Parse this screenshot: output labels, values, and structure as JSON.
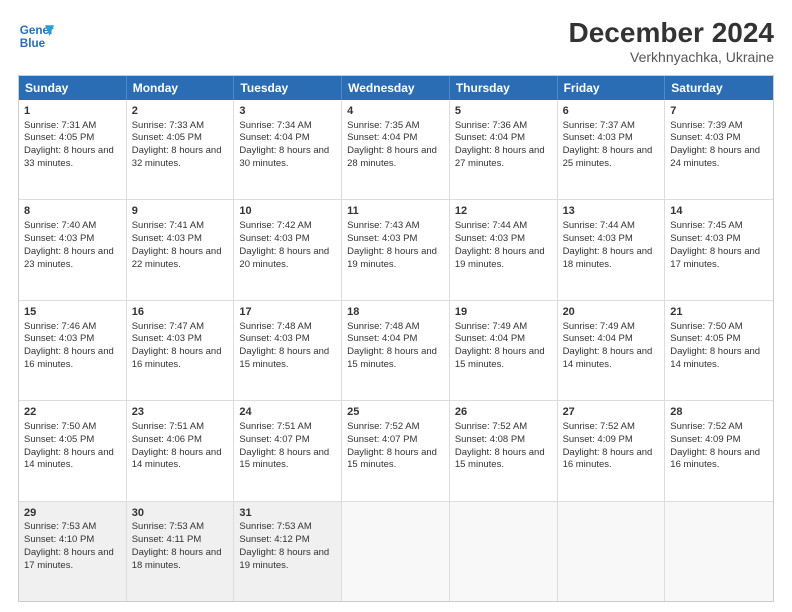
{
  "header": {
    "logo_line1": "General",
    "logo_line2": "Blue",
    "title": "December 2024",
    "subtitle": "Verkhnyachka, Ukraine"
  },
  "days_of_week": [
    "Sunday",
    "Monday",
    "Tuesday",
    "Wednesday",
    "Thursday",
    "Friday",
    "Saturday"
  ],
  "weeks": [
    [
      {
        "day": 1,
        "sunrise": "7:31 AM",
        "sunset": "4:05 PM",
        "daylight": "8 hours and 33 minutes."
      },
      {
        "day": 2,
        "sunrise": "7:33 AM",
        "sunset": "4:05 PM",
        "daylight": "8 hours and 32 minutes."
      },
      {
        "day": 3,
        "sunrise": "7:34 AM",
        "sunset": "4:04 PM",
        "daylight": "8 hours and 30 minutes."
      },
      {
        "day": 4,
        "sunrise": "7:35 AM",
        "sunset": "4:04 PM",
        "daylight": "8 hours and 28 minutes."
      },
      {
        "day": 5,
        "sunrise": "7:36 AM",
        "sunset": "4:04 PM",
        "daylight": "8 hours and 27 minutes."
      },
      {
        "day": 6,
        "sunrise": "7:37 AM",
        "sunset": "4:03 PM",
        "daylight": "8 hours and 25 minutes."
      },
      {
        "day": 7,
        "sunrise": "7:39 AM",
        "sunset": "4:03 PM",
        "daylight": "8 hours and 24 minutes."
      }
    ],
    [
      {
        "day": 8,
        "sunrise": "7:40 AM",
        "sunset": "4:03 PM",
        "daylight": "8 hours and 23 minutes."
      },
      {
        "day": 9,
        "sunrise": "7:41 AM",
        "sunset": "4:03 PM",
        "daylight": "8 hours and 22 minutes."
      },
      {
        "day": 10,
        "sunrise": "7:42 AM",
        "sunset": "4:03 PM",
        "daylight": "8 hours and 20 minutes."
      },
      {
        "day": 11,
        "sunrise": "7:43 AM",
        "sunset": "4:03 PM",
        "daylight": "8 hours and 19 minutes."
      },
      {
        "day": 12,
        "sunrise": "7:44 AM",
        "sunset": "4:03 PM",
        "daylight": "8 hours and 19 minutes."
      },
      {
        "day": 13,
        "sunrise": "7:44 AM",
        "sunset": "4:03 PM",
        "daylight": "8 hours and 18 minutes."
      },
      {
        "day": 14,
        "sunrise": "7:45 AM",
        "sunset": "4:03 PM",
        "daylight": "8 hours and 17 minutes."
      }
    ],
    [
      {
        "day": 15,
        "sunrise": "7:46 AM",
        "sunset": "4:03 PM",
        "daylight": "8 hours and 16 minutes."
      },
      {
        "day": 16,
        "sunrise": "7:47 AM",
        "sunset": "4:03 PM",
        "daylight": "8 hours and 16 minutes."
      },
      {
        "day": 17,
        "sunrise": "7:48 AM",
        "sunset": "4:03 PM",
        "daylight": "8 hours and 15 minutes."
      },
      {
        "day": 18,
        "sunrise": "7:48 AM",
        "sunset": "4:04 PM",
        "daylight": "8 hours and 15 minutes."
      },
      {
        "day": 19,
        "sunrise": "7:49 AM",
        "sunset": "4:04 PM",
        "daylight": "8 hours and 15 minutes."
      },
      {
        "day": 20,
        "sunrise": "7:49 AM",
        "sunset": "4:04 PM",
        "daylight": "8 hours and 14 minutes."
      },
      {
        "day": 21,
        "sunrise": "7:50 AM",
        "sunset": "4:05 PM",
        "daylight": "8 hours and 14 minutes."
      }
    ],
    [
      {
        "day": 22,
        "sunrise": "7:50 AM",
        "sunset": "4:05 PM",
        "daylight": "8 hours and 14 minutes."
      },
      {
        "day": 23,
        "sunrise": "7:51 AM",
        "sunset": "4:06 PM",
        "daylight": "8 hours and 14 minutes."
      },
      {
        "day": 24,
        "sunrise": "7:51 AM",
        "sunset": "4:07 PM",
        "daylight": "8 hours and 15 minutes."
      },
      {
        "day": 25,
        "sunrise": "7:52 AM",
        "sunset": "4:07 PM",
        "daylight": "8 hours and 15 minutes."
      },
      {
        "day": 26,
        "sunrise": "7:52 AM",
        "sunset": "4:08 PM",
        "daylight": "8 hours and 15 minutes."
      },
      {
        "day": 27,
        "sunrise": "7:52 AM",
        "sunset": "4:09 PM",
        "daylight": "8 hours and 16 minutes."
      },
      {
        "day": 28,
        "sunrise": "7:52 AM",
        "sunset": "4:09 PM",
        "daylight": "8 hours and 16 minutes."
      }
    ],
    [
      {
        "day": 29,
        "sunrise": "7:53 AM",
        "sunset": "4:10 PM",
        "daylight": "8 hours and 17 minutes."
      },
      {
        "day": 30,
        "sunrise": "7:53 AM",
        "sunset": "4:11 PM",
        "daylight": "8 hours and 18 minutes."
      },
      {
        "day": 31,
        "sunrise": "7:53 AM",
        "sunset": "4:12 PM",
        "daylight": "8 hours and 19 minutes."
      },
      null,
      null,
      null,
      null
    ]
  ]
}
